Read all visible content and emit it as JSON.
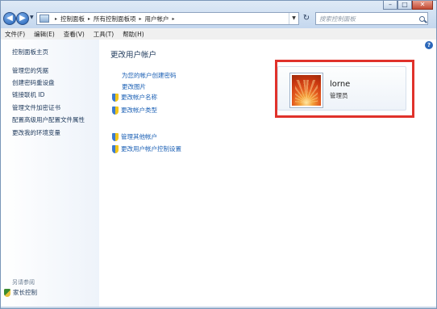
{
  "window": {
    "controls": {
      "minimize": "–",
      "maximize": "□",
      "close": "✕"
    }
  },
  "nav": {
    "back_glyph": "◀",
    "forward_glyph": "▶",
    "breadcrumbs": [
      "控制面板",
      "所有控制面板项",
      "用户帐户"
    ],
    "separator": "▸",
    "refresh_glyph": "↻",
    "search_placeholder": "搜索控制面板"
  },
  "menu": [
    "文件(F)",
    "编辑(E)",
    "查看(V)",
    "工具(T)",
    "帮助(H)"
  ],
  "sidebar": {
    "items": [
      "控制面板主页",
      "管理您的凭据",
      "创建密码重设盘",
      "链接联机 ID",
      "管理文件加密证书",
      "配置高级用户配置文件属性",
      "更改我的环境变量"
    ],
    "see_also_label": "另请参阅",
    "family_safety": "家长控制"
  },
  "main": {
    "title": "更改用户帐户",
    "help_glyph": "?",
    "links": [
      {
        "label": "为您的帐户创建密码",
        "shield": false
      },
      {
        "label": "更改图片",
        "shield": false
      },
      {
        "label": "更改帐户名称",
        "shield": true
      },
      {
        "label": "更改帐户类型",
        "shield": true
      }
    ],
    "links_other": [
      {
        "label": "管理其他帐户",
        "shield": true
      },
      {
        "label": "更改用户帐户控制设置",
        "shield": true
      }
    ],
    "account": {
      "name": "lorne",
      "role": "管理员"
    }
  },
  "colors": {
    "link": "#1a5fb4",
    "highlight_border": "#e0322b"
  }
}
